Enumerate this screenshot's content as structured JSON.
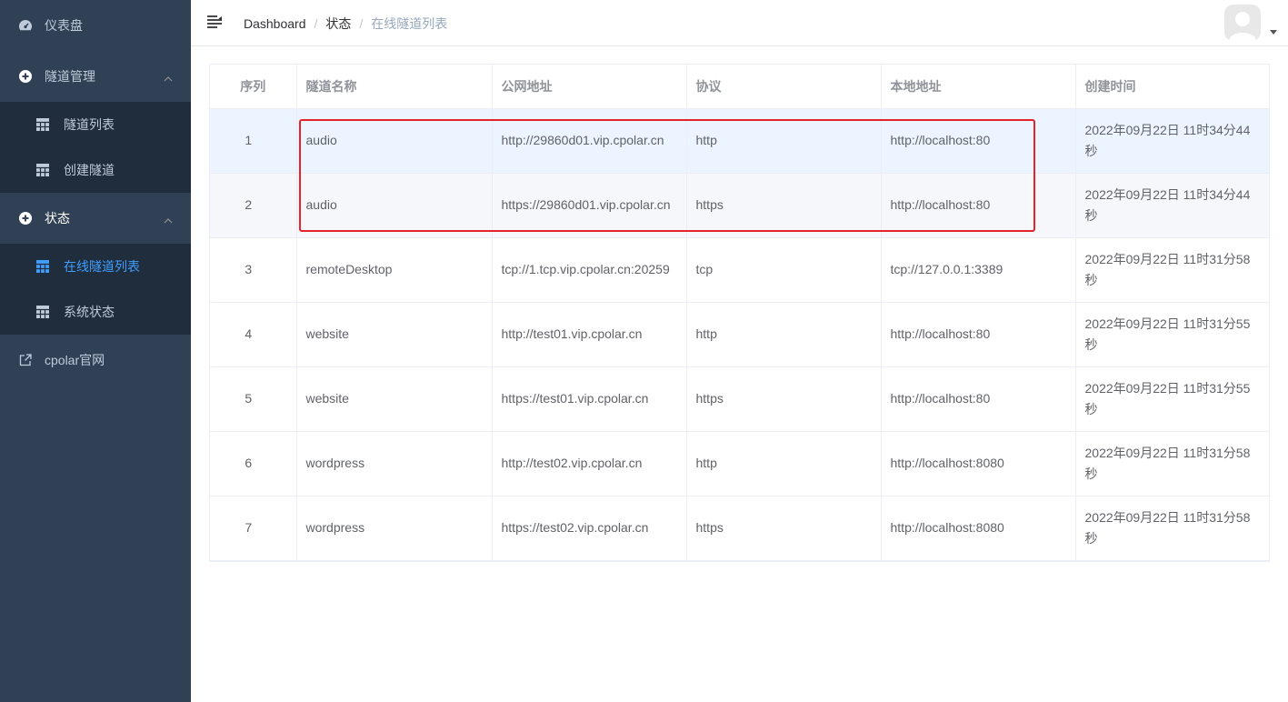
{
  "sidebar": {
    "dashboard": {
      "label": "仪表盘",
      "icon": "dashboard-icon"
    },
    "tunnel_mgmt": {
      "label": "隧道管理",
      "icon": "plus-circle-icon",
      "items": [
        {
          "label": "隧道列表",
          "icon": "table-icon"
        },
        {
          "label": "创建隧道",
          "icon": "table-icon"
        }
      ]
    },
    "status": {
      "label": "状态",
      "icon": "plus-circle-icon",
      "items": [
        {
          "label": "在线隧道列表",
          "icon": "table-icon",
          "active": true
        },
        {
          "label": "系统状态",
          "icon": "table-icon"
        }
      ]
    },
    "cpolar_site": {
      "label": "cpolar官网",
      "icon": "external-link-icon"
    }
  },
  "header": {
    "breadcrumb": [
      "Dashboard",
      "状态",
      "在线隧道列表"
    ],
    "separator": "/"
  },
  "table": {
    "columns": [
      "序列",
      "隧道名称",
      "公网地址",
      "协议",
      "本地地址",
      "创建时间"
    ],
    "rows": [
      {
        "index": "1",
        "name": "audio",
        "public_url": "http://29860d01.vip.cpolar.cn",
        "protocol": "http",
        "local": "http://localhost:80",
        "created_line1": "2022年09月22日 11时34分44",
        "created_line2": "秒"
      },
      {
        "index": "2",
        "name": "audio",
        "public_url": "https://29860d01.vip.cpolar.cn",
        "protocol": "https",
        "local": "http://localhost:80",
        "created_line1": "2022年09月22日 11时34分44",
        "created_line2": "秒"
      },
      {
        "index": "3",
        "name": "remoteDesktop",
        "public_url": "tcp://1.tcp.vip.cpolar.cn:20259",
        "protocol": "tcp",
        "local": "tcp://127.0.0.1:3389",
        "created_line1": "2022年09月22日 11时31分58",
        "created_line2": "秒"
      },
      {
        "index": "4",
        "name": "website",
        "public_url": "http://test01.vip.cpolar.cn",
        "protocol": "http",
        "local": "http://localhost:80",
        "created_line1": "2022年09月22日 11时31分55",
        "created_line2": "秒"
      },
      {
        "index": "5",
        "name": "website",
        "public_url": "https://test01.vip.cpolar.cn",
        "protocol": "https",
        "local": "http://localhost:80",
        "created_line1": "2022年09月22日 11时31分55",
        "created_line2": "秒"
      },
      {
        "index": "6",
        "name": "wordpress",
        "public_url": "http://test02.vip.cpolar.cn",
        "protocol": "http",
        "local": "http://localhost:8080",
        "created_line1": "2022年09月22日 11时31分58",
        "created_line2": "秒"
      },
      {
        "index": "7",
        "name": "wordpress",
        "public_url": "https://test02.vip.cpolar.cn",
        "protocol": "https",
        "local": "http://localhost:8080",
        "created_line1": "2022年09月22日 11时31分58",
        "created_line2": "秒"
      }
    ]
  },
  "colors": {
    "sidebar_bg": "#304156",
    "submenu_bg": "#1f2d3d",
    "active": "#409eff",
    "highlight": "#e3242b"
  }
}
